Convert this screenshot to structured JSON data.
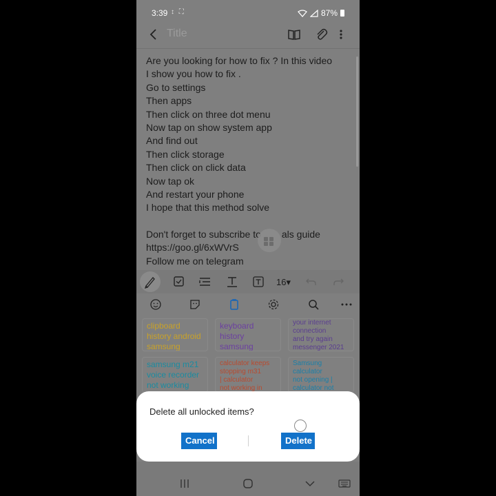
{
  "status": {
    "time": "3:39",
    "left_icons": "↕ ⛶",
    "battery": "87%"
  },
  "app_bar": {
    "title_placeholder": "Title"
  },
  "note": {
    "lines": [
      "Are you looking for how to fix  ?  In this video",
      "I show you how to fix  .",
      "Go to settings",
      "Then apps",
      "Then click on three dot menu",
      "Now tap on show system app",
      "And find out",
      "Then click storage",
      "Then click on click data",
      "Now tap ok",
      "And restart your phone",
      "I hope that this method solve",
      "",
      "Don't forget to subscribe to",
      "https://goo.gl/6xWVrS",
      "Follow me on telegram"
    ],
    "line13_tail": "als guide"
  },
  "format_bar": {
    "font_size": "16▾"
  },
  "clipboard": {
    "cards": [
      {
        "lines": [
          "clipboard",
          "history android",
          "samsung"
        ],
        "color": "#c9a227"
      },
      {
        "lines": [
          "keyboard",
          "history",
          "samsung"
        ],
        "color": "#6b3fa0"
      },
      {
        "lines": [
          "your internet",
          "connection",
          "and try again",
          "messenger 2021"
        ],
        "color": "#5a3d8f"
      },
      {
        "lines": [
          "samsung m21",
          "voice recorder",
          "not working"
        ],
        "color": "#1a8ba0"
      },
      {
        "lines": [
          "calculator keeps",
          "stopping m31",
          "| calculator",
          "not working in"
        ],
        "color": "#b84a2f"
      },
      {
        "lines": [
          "Samsung",
          "calculator",
          "not opening |",
          "calculator not"
        ],
        "color": "#1a7fa8"
      }
    ]
  },
  "dialog": {
    "message": "Delete all unlocked items?",
    "cancel_label": "Cancel",
    "delete_label": "Delete",
    "accent": "#1272c9"
  }
}
